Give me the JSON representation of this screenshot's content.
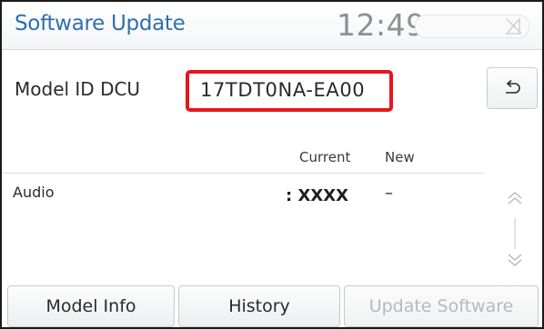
{
  "header": {
    "title": "Software Update",
    "clock": "12:49",
    "status_icon": "no-signal-icon"
  },
  "model": {
    "label": "Model ID DCU",
    "value": "17TDT0NA-EA00",
    "highlight_color": "#e8141b"
  },
  "back_button": {
    "icon": "back-arrow-icon"
  },
  "table": {
    "columns": [
      "Current",
      "New"
    ],
    "rows": [
      {
        "name": "Audio",
        "current": ": XXXX",
        "new": "–"
      }
    ]
  },
  "scroll": {
    "up_icon": "double-chevron-up-icon",
    "down_icon": "double-chevron-down-icon"
  },
  "buttons": {
    "model_info": "Model Info",
    "history": "History",
    "update_software": "Update Software"
  },
  "colors": {
    "title": "#2f6fab",
    "clock": "#8e9093",
    "disabled_text": "#b6b9bd"
  }
}
